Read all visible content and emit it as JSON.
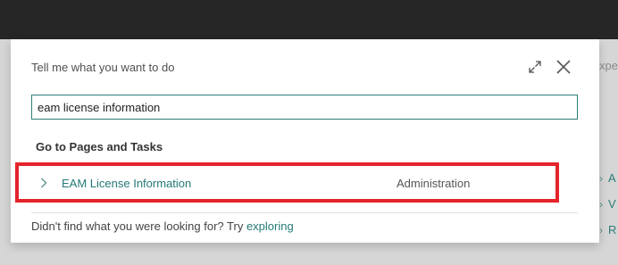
{
  "background": {
    "partial_text": "xpe",
    "links": [
      {
        "label": "A"
      },
      {
        "label": "V"
      },
      {
        "label": "R"
      }
    ]
  },
  "dialog": {
    "title": "Tell me what you want to do",
    "expand_icon": "expand-icon",
    "close_icon": "close-icon",
    "search": {
      "value": "eam license information"
    },
    "section_heading": "Go to Pages and Tasks",
    "results": [
      {
        "label": "EAM License Information",
        "category": "Administration",
        "icon": "chevron-right-icon",
        "highlighted": true,
        "highlight_color": "#e3242b"
      }
    ],
    "footer": {
      "prefix": "Didn't find what you were looking for? Try",
      "link_label": "exploring"
    }
  },
  "colors": {
    "accent": "#2e7d7a",
    "link": "#247a77",
    "topbar": "#262626"
  }
}
